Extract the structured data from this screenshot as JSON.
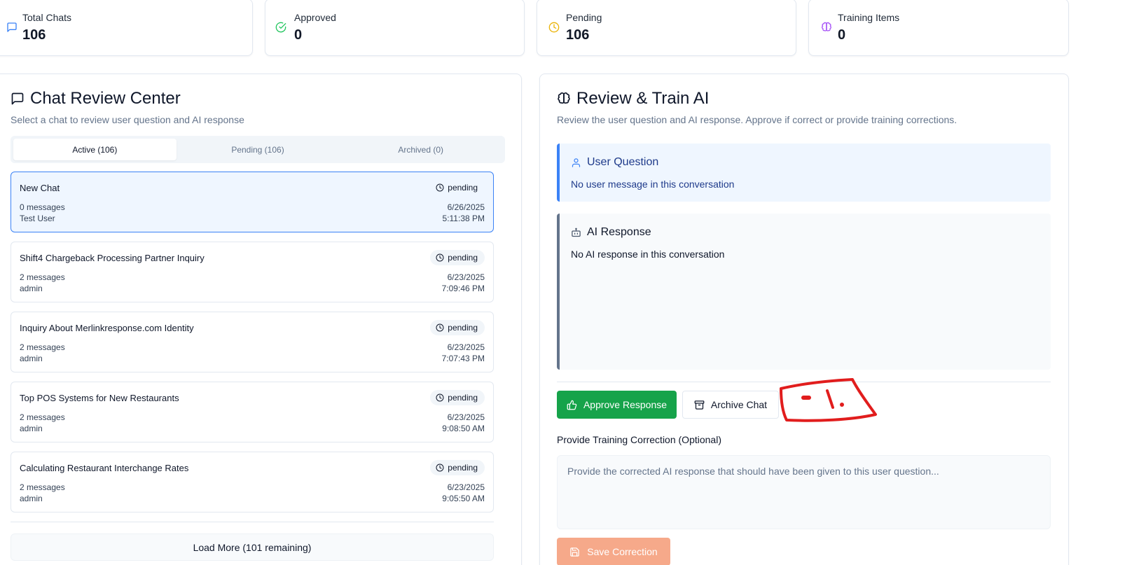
{
  "stats": [
    {
      "label": "Total Chats",
      "value": "106",
      "icon": "message-square-icon",
      "color": "#3b82f6"
    },
    {
      "label": "Approved",
      "value": "0",
      "icon": "check-circle-icon",
      "color": "#22c55e"
    },
    {
      "label": "Pending",
      "value": "106",
      "icon": "clock-icon",
      "color": "#eab308"
    },
    {
      "label": "Training Items",
      "value": "0",
      "icon": "brain-icon",
      "color": "#a855f7"
    }
  ],
  "chat_review": {
    "title": "Chat Review Center",
    "subtitle": "Select a chat to review user question and AI response",
    "tabs": [
      {
        "label": "Active (106)",
        "active": true
      },
      {
        "label": "Pending (106)",
        "active": false
      },
      {
        "label": "Archived (0)",
        "active": false
      }
    ],
    "chats": [
      {
        "title": "New Chat",
        "status": "pending",
        "messages": "0 messages",
        "user": "Test User",
        "date": "6/26/2025",
        "time": "5:11:38 PM",
        "selected": true
      },
      {
        "title": "Shift4 Chargeback Processing Partner Inquiry",
        "status": "pending",
        "messages": "2 messages",
        "user": "admin",
        "date": "6/23/2025",
        "time": "7:09:46 PM",
        "selected": false
      },
      {
        "title": "Inquiry About Merlinkresponse.com Identity",
        "status": "pending",
        "messages": "2 messages",
        "user": "admin",
        "date": "6/23/2025",
        "time": "7:07:43 PM",
        "selected": false
      },
      {
        "title": "Top POS Systems for New Restaurants",
        "status": "pending",
        "messages": "2 messages",
        "user": "admin",
        "date": "6/23/2025",
        "time": "9:08:50 AM",
        "selected": false
      },
      {
        "title": "Calculating Restaurant Interchange Rates",
        "status": "pending",
        "messages": "2 messages",
        "user": "admin",
        "date": "6/23/2025",
        "time": "9:05:50 AM",
        "selected": false
      }
    ],
    "load_more": "Load More (101 remaining)"
  },
  "review_train": {
    "title": "Review & Train AI",
    "subtitle": "Review the user question and AI response. Approve if correct or provide training corrections.",
    "user_question": {
      "label": "User Question",
      "text": "No user message in this conversation",
      "color": "#1e3a8a"
    },
    "ai_response": {
      "label": "AI Response",
      "text": "No AI response in this conversation"
    },
    "approve_label": "Approve Response",
    "archive_label": "Archive Chat",
    "training_label": "Provide Training Correction (Optional)",
    "training_placeholder": "Provide the corrected AI response that should have been given to this user question...",
    "save_label": "Save Correction"
  }
}
